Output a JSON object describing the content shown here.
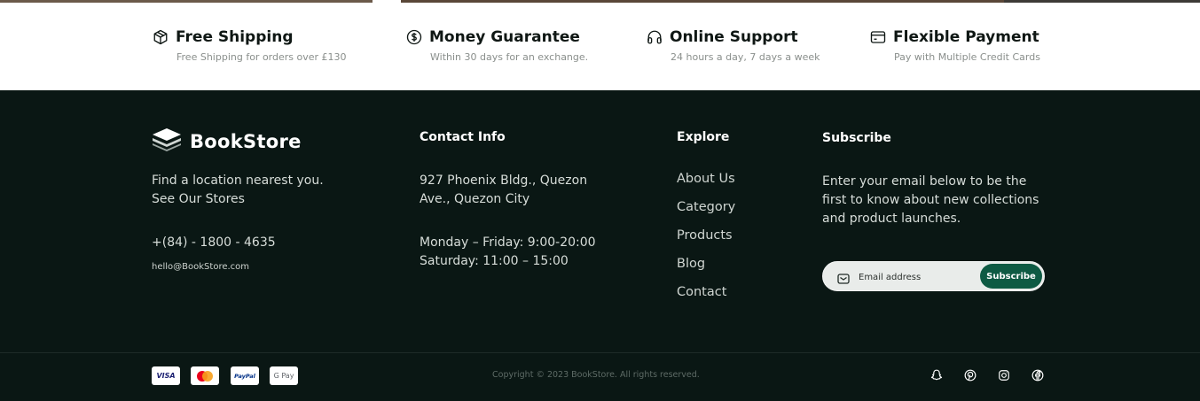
{
  "features": [
    {
      "icon": "package-icon",
      "title": "Free Shipping",
      "subtitle": "Free Shipping for orders over £130"
    },
    {
      "icon": "dollar-circle-icon",
      "title": "Money Guarantee",
      "subtitle": "Within 30 days for an exchange."
    },
    {
      "icon": "headphones-icon",
      "title": "Online Support",
      "subtitle": "24 hours a day, 7 days a week"
    },
    {
      "icon": "credit-card-icon",
      "title": "Flexible Payment",
      "subtitle": "Pay with Multiple Credit Cards"
    }
  ],
  "footer": {
    "brand": {
      "logo_icon": "book-stack-icon",
      "name": "BookStore",
      "tagline_line1": "Find a location nearest you.",
      "tagline_line2": "See Our Stores",
      "phone": "+(84) - 1800 - 4635",
      "email": "hello@BookStore.com"
    },
    "contact": {
      "title": "Contact Info",
      "address_line1": "927 Phoenix Bldg., Quezon",
      "address_line2": "Ave., Quezon City",
      "hours_line1": "Monday – Friday: 9:00-20:00",
      "hours_line2": "Saturday: 11:00 – 15:00"
    },
    "explore": {
      "title": "Explore",
      "links": [
        "About Us",
        "Category",
        "Products",
        "Blog",
        "Contact"
      ]
    },
    "subscribe": {
      "title": "Subscribe",
      "line1": "Enter your email below to be the",
      "line2": "first to know about new collections",
      "line3": "and product launches.",
      "placeholder": "Email address",
      "button": "Subscribe"
    },
    "payments": [
      {
        "name": "VISA",
        "color": "#1a1f71"
      },
      {
        "name": "mastercard",
        "color": "#eb001b"
      },
      {
        "name": "PayPal",
        "color": "#003087"
      },
      {
        "name": "G Pay",
        "color": "#5f6368"
      }
    ],
    "copyright": "Copyright © 2023 BookStore. All rights reserved.",
    "social": [
      "snapchat-icon",
      "pinterest-icon",
      "instagram-icon",
      "facebook-icon"
    ]
  },
  "colors": {
    "footer_bg": "#0a1714",
    "accent": "#0e5a43"
  }
}
